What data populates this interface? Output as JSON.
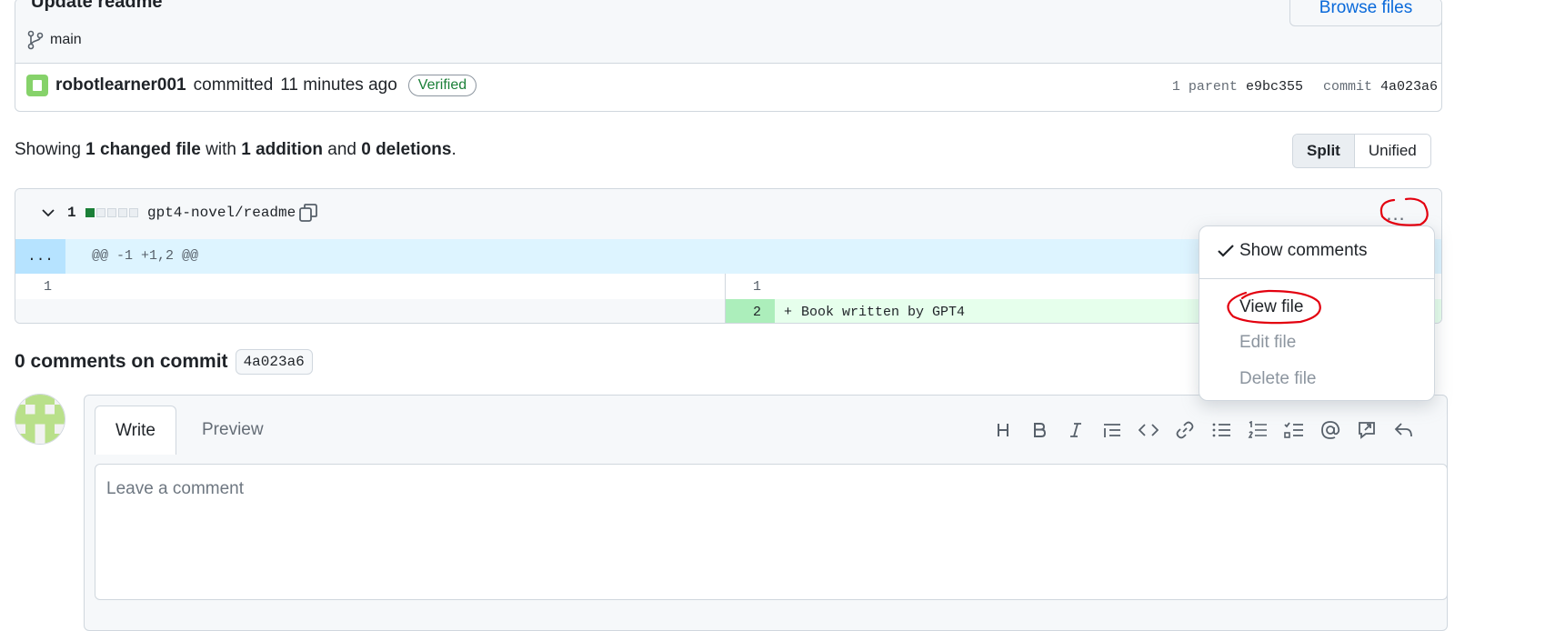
{
  "commit": {
    "title": "Update readme",
    "branch": "main",
    "browse_label": "Browse files",
    "author": "robotlearner001",
    "action": "committed",
    "time": "11 minutes ago",
    "verified": "Verified",
    "parent_label": "1 parent",
    "parent_sha": "e9bc355",
    "commit_label": "commit",
    "commit_sha": "4a023a6"
  },
  "summary": {
    "prefix": "Showing",
    "changed": "1 changed file",
    "with": "with",
    "additions": "1 addition",
    "and": "and",
    "deletions": "0 deletions",
    "end": "."
  },
  "view_toggle": {
    "split": "Split",
    "unified": "Unified"
  },
  "file": {
    "count": "1",
    "name": "gpt4-novel/readme",
    "more": "...",
    "hunk_expand": "...",
    "hunk_header": "@@ -1 +1,2 @@",
    "left_line1": "1",
    "right_line1": "1",
    "right_line2": "2",
    "added_prefix": "+",
    "added_text": "Book written by GPT4"
  },
  "dropdown": {
    "show_comments": "Show comments",
    "view_file": "View file",
    "edit_file": "Edit file",
    "delete_file": "Delete file"
  },
  "comments": {
    "title": "0 comments on commit",
    "sha": "4a023a6"
  },
  "editor": {
    "tab_write": "Write",
    "tab_preview": "Preview",
    "placeholder": "Leave a comment"
  },
  "colors": {
    "link": "#0969da",
    "verified": "#1a7f37",
    "annotation": "#e3000f",
    "hunk_bg": "#ddf4ff",
    "addition_bg": "#e6ffec"
  }
}
